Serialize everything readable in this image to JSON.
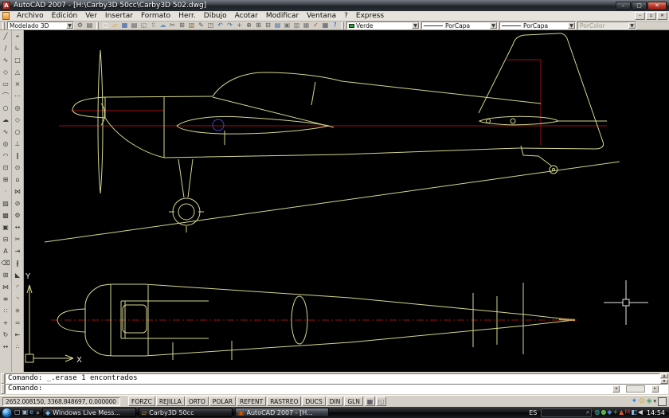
{
  "window": {
    "title": "AutoCAD 2007 - [H:\\Carby3D 50cc\\Carby3D 502.dwg]",
    "app_icon_letter": "A",
    "minimize_glyph": "–",
    "maximize_glyph": "▢",
    "close_glyph": "✕",
    "child_minimize_glyph": "–",
    "child_restore_glyph": "▫",
    "child_close_glyph": "✕"
  },
  "menus": [
    "Archivo",
    "Edición",
    "Ver",
    "Insertar",
    "Formato",
    "Herr.",
    "Dibujo",
    "Acotar",
    "Modificar",
    "Ventana",
    "?",
    "Express"
  ],
  "workspace": {
    "label": "Modelado 3D",
    "caret": "▼"
  },
  "workspace_icons": [
    {
      "name": "workspace-settings-icon",
      "glyph": "⚙",
      "color": "#555"
    },
    {
      "name": "workspace-save-icon",
      "glyph": "▤",
      "color": "#555"
    }
  ],
  "standard_toolbar": [
    {
      "name": "new-icon",
      "glyph": "▢",
      "color": "#f8f8f8"
    },
    {
      "name": "open-icon",
      "glyph": "▱",
      "color": "#d99a2b"
    },
    {
      "name": "save-icon",
      "glyph": "▦",
      "color": "#2f5fa8"
    },
    {
      "name": "plot-icon",
      "glyph": "▤",
      "color": "#555"
    },
    {
      "name": "plot-preview-icon",
      "glyph": "◱",
      "color": "#777"
    },
    {
      "name": "publish-icon",
      "glyph": "⇧",
      "color": "#777"
    },
    {
      "name": "3d-dwf-icon",
      "glyph": "☁",
      "color": "#6a8fc0"
    },
    {
      "name": "cut-icon",
      "glyph": "✂",
      "color": "#555"
    },
    {
      "name": "copy-icon",
      "glyph": "⊞",
      "color": "#555"
    },
    {
      "name": "paste-icon",
      "glyph": "▥",
      "color": "#8a6d3b"
    },
    {
      "name": "match-properties-icon",
      "glyph": "✎",
      "color": "#555"
    },
    {
      "name": "block-editor-icon",
      "glyph": "◳",
      "color": "#555"
    },
    {
      "name": "undo-icon",
      "glyph": "↶",
      "color": "#2f5fa8"
    },
    {
      "name": "redo-icon",
      "glyph": "↷",
      "color": "#2f5fa8"
    },
    {
      "name": "pan-icon",
      "glyph": "+",
      "color": "#555"
    },
    {
      "name": "zoom-realtime-icon",
      "glyph": "⊕",
      "color": "#555"
    },
    {
      "name": "zoom-window-icon",
      "glyph": "⊞",
      "color": "#555"
    },
    {
      "name": "zoom-previous-icon",
      "glyph": "⊟",
      "color": "#555"
    },
    {
      "name": "properties-icon",
      "glyph": "▤",
      "color": "#3b6ea5"
    },
    {
      "name": "designcenter-icon",
      "glyph": "▣",
      "color": "#777"
    },
    {
      "name": "tool-palettes-icon",
      "glyph": "▥",
      "color": "#777"
    },
    {
      "name": "sheet-set-manager-icon",
      "glyph": "▦",
      "color": "#777"
    },
    {
      "name": "markup-icon",
      "glyph": "✓",
      "color": "#b33"
    },
    {
      "name": "quickcalc-icon",
      "glyph": "▦",
      "color": "#556"
    },
    {
      "name": "help-icon",
      "glyph": "?",
      "color": "#2255cc"
    }
  ],
  "properties_bar": {
    "color_label": "Verde",
    "linetype_label": "PorCapa",
    "lineweight_label": "PorCapa",
    "plotstyle_label": "PorColor",
    "caret": "▼"
  },
  "draw_toolbar": [
    {
      "name": "line-icon",
      "glyph": "╱"
    },
    {
      "name": "construction-line-icon",
      "glyph": "∕"
    },
    {
      "name": "polyline-icon",
      "glyph": "∿"
    },
    {
      "name": "polygon-icon",
      "glyph": "◇"
    },
    {
      "name": "rectangle-icon",
      "glyph": "▭"
    },
    {
      "name": "arc-icon",
      "glyph": "⌒"
    },
    {
      "name": "circle-icon",
      "glyph": "○"
    },
    {
      "name": "revcloud-icon",
      "glyph": "☁"
    },
    {
      "name": "spline-icon",
      "glyph": "∿"
    },
    {
      "name": "ellipse-icon",
      "glyph": "◎"
    },
    {
      "name": "ellipse-arc-icon",
      "glyph": "◠"
    },
    {
      "name": "insert-block-icon",
      "glyph": "⊡"
    },
    {
      "name": "make-block-icon",
      "glyph": "⊞"
    },
    {
      "name": "point-icon",
      "glyph": "·"
    },
    {
      "name": "hatch-icon",
      "glyph": "▨"
    },
    {
      "name": "gradient-icon",
      "glyph": "▩"
    },
    {
      "name": "region-icon",
      "glyph": "▣"
    },
    {
      "name": "table-icon",
      "glyph": "⊟"
    },
    {
      "name": "mtext-icon",
      "glyph": "A"
    },
    {
      "name": "erase-icon",
      "glyph": "⌫"
    },
    {
      "name": "copy-object-icon",
      "glyph": "⊞"
    },
    {
      "name": "mirror-icon",
      "glyph": "⋈"
    },
    {
      "name": "offset-icon",
      "glyph": "≡"
    },
    {
      "name": "array-icon",
      "glyph": "∷"
    },
    {
      "name": "move-icon",
      "glyph": "+"
    },
    {
      "name": "rotate-icon",
      "glyph": "↻"
    },
    {
      "name": "scale-icon",
      "glyph": "↔"
    }
  ],
  "modify_toolbar": [
    {
      "name": "temporary-track-icon",
      "glyph": "⌖"
    },
    {
      "name": "snap-from-icon",
      "glyph": "∟"
    },
    {
      "name": "snap-endpoint-icon",
      "glyph": "□"
    },
    {
      "name": "snap-midpoint-icon",
      "glyph": "△"
    },
    {
      "name": "snap-intersection-icon",
      "glyph": "×"
    },
    {
      "name": "snap-extension-icon",
      "glyph": "⋯"
    },
    {
      "name": "snap-center-icon",
      "glyph": "◎"
    },
    {
      "name": "snap-quadrant-icon",
      "glyph": "◇"
    },
    {
      "name": "snap-tangent-icon",
      "glyph": "○"
    },
    {
      "name": "snap-perpendicular-icon",
      "glyph": "⊥"
    },
    {
      "name": "snap-parallel-icon",
      "glyph": "∥"
    },
    {
      "name": "snap-node-icon",
      "glyph": "⊙"
    },
    {
      "name": "snap-insertion-icon",
      "glyph": "⌂"
    },
    {
      "name": "snap-nearest-icon",
      "glyph": "⋈"
    },
    {
      "name": "snap-none-icon",
      "glyph": "⊘"
    },
    {
      "name": "osnap-settings-icon",
      "glyph": "⚙"
    },
    {
      "name": "stretch-icon",
      "glyph": "↔"
    },
    {
      "name": "trim-icon",
      "glyph": "✂"
    },
    {
      "name": "extend-icon",
      "glyph": "⇥"
    },
    {
      "name": "break-point-icon",
      "glyph": "∦"
    },
    {
      "name": "break-icon",
      "glyph": "◣"
    },
    {
      "name": "chamfer-icon",
      "glyph": "◜"
    },
    {
      "name": "fillet-icon",
      "glyph": "◝"
    },
    {
      "name": "explode-icon",
      "glyph": "✳"
    },
    {
      "name": "join-icon",
      "glyph": "≍"
    },
    {
      "name": "lengthen-icon",
      "glyph": "⇤"
    },
    {
      "name": "divide-icon",
      "glyph": "∴"
    }
  ],
  "canvas": {
    "ucs_y": "Y",
    "ucs_x": "X"
  },
  "command_line": {
    "history": "Comando: _.erase 1 encontrados",
    "prompt": "Comando:",
    "scroll_up": "▲",
    "scroll_down": "▼",
    "scroll_left": "◄",
    "scroll_right": "►"
  },
  "status_bar": {
    "coordinates": "2652.008150, 3368.848697, 0.000000",
    "toggles": [
      "FORZC",
      "REJILLA",
      "ORTO",
      "POLAR",
      "REFENT",
      "RASTREO",
      "DUCS",
      "DIN",
      "GLN"
    ],
    "icon_buttons": [
      {
        "name": "model-paper-toggle-icon",
        "glyph": "▦",
        "color": "#334"
      },
      {
        "name": "maximize-viewport-icon",
        "glyph": "◱",
        "color": "#667"
      }
    ],
    "tray_icons": [
      {
        "name": "communication-center-icon",
        "glyph": "✦",
        "color": "#3b7dd8"
      },
      {
        "name": "toolbar-lock-icon",
        "glyph": "⊙",
        "color": "#c9a227"
      },
      {
        "name": "standards-icon",
        "glyph": "◈",
        "color": "#4a9f5e"
      }
    ],
    "caret": "▾"
  },
  "taskbar": {
    "quick_launch": [
      {
        "name": "show-desktop-icon",
        "glyph": "▢",
        "color": "#bcd2e8"
      },
      {
        "name": "window-switcher-icon",
        "glyph": "▣",
        "color": "#9fb6c9"
      },
      {
        "name": "internet-explorer-icon",
        "glyph": "e",
        "color": "#63aee8"
      }
    ],
    "overflow_chevron": "»",
    "tasks": [
      {
        "name": "task-windows-live-messenger",
        "glyph": "◆",
        "color": "#6fb7e8",
        "label": "Windows Live Mess..."
      },
      {
        "name": "task-carby3d-folder",
        "glyph": "▱",
        "color": "#e8c34a",
        "label": "Carby3D 50cc"
      },
      {
        "name": "task-autocad",
        "glyph": "▣",
        "color": "#d45500",
        "label": "AutoCAD 2007 - [H...",
        "active": true
      }
    ],
    "language": "ES",
    "search_icon": "⌕",
    "tray_icons": [
      {
        "name": "tray-icon-chat",
        "glyph": "◍",
        "color": "#39b7b0"
      },
      {
        "name": "tray-icon-update",
        "glyph": "●",
        "color": "#5cb544"
      },
      {
        "name": "tray-icon-network",
        "glyph": "◆",
        "color": "#4f7ede"
      },
      {
        "name": "tray-icon-shield",
        "glyph": "+",
        "color": "#6fc13a"
      },
      {
        "name": "tray-icon-warning",
        "glyph": "▲",
        "color": "#d8593a"
      },
      {
        "name": "tray-icon-antivirus",
        "glyph": "M",
        "color": "#cc3333"
      },
      {
        "name": "tray-icon-display",
        "glyph": "◧",
        "color": "#8fb7e0"
      },
      {
        "name": "volume-icon",
        "glyph": "◀",
        "color": "#d0d0d0"
      }
    ],
    "clock": "14:54"
  },
  "colors": {
    "canvas_bg": "#000000",
    "cad_line": "#d6d68e",
    "cad_center": "#9b0f0f",
    "cad_mark": "#4646c8",
    "cad_cross": "#e8e8e8",
    "layer_green": "#1faa1f"
  }
}
